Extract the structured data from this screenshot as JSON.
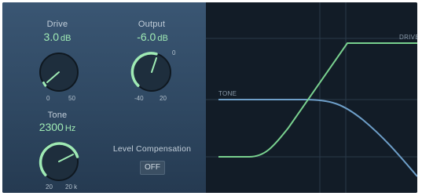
{
  "drive": {
    "label": "Drive",
    "value": "3.0",
    "unit": "dB",
    "min_tick": "0",
    "max_tick": "50"
  },
  "output": {
    "label": "Output",
    "value": "-6.0",
    "unit": "dB",
    "min_tick": "-40",
    "mid_tick": "0",
    "max_tick": "20"
  },
  "tone": {
    "label": "Tone",
    "value": "2300",
    "unit": "Hz",
    "min_tick": "20",
    "max_tick": "20 k"
  },
  "level_compensation": {
    "label": "Level Compensation",
    "state": "OFF"
  },
  "graph": {
    "tone_label": "TONE",
    "drive_label": "DRIVE"
  },
  "colors": {
    "accent_green": "#9feab4",
    "tone_curve": "#6e9fc9",
    "drive_curve": "#79d18f"
  }
}
